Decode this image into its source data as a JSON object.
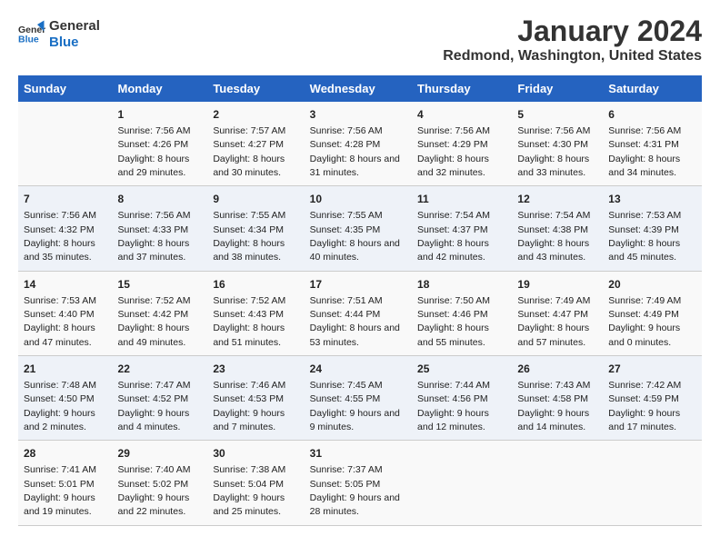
{
  "header": {
    "logo_line1": "General",
    "logo_line2": "Blue",
    "title": "January 2024",
    "subtitle": "Redmond, Washington, United States"
  },
  "days_of_week": [
    "Sunday",
    "Monday",
    "Tuesday",
    "Wednesday",
    "Thursday",
    "Friday",
    "Saturday"
  ],
  "weeks": [
    [
      {
        "day": "",
        "sunrise": "",
        "sunset": "",
        "daylight": ""
      },
      {
        "day": "1",
        "sunrise": "Sunrise: 7:56 AM",
        "sunset": "Sunset: 4:26 PM",
        "daylight": "Daylight: 8 hours and 29 minutes."
      },
      {
        "day": "2",
        "sunrise": "Sunrise: 7:57 AM",
        "sunset": "Sunset: 4:27 PM",
        "daylight": "Daylight: 8 hours and 30 minutes."
      },
      {
        "day": "3",
        "sunrise": "Sunrise: 7:56 AM",
        "sunset": "Sunset: 4:28 PM",
        "daylight": "Daylight: 8 hours and 31 minutes."
      },
      {
        "day": "4",
        "sunrise": "Sunrise: 7:56 AM",
        "sunset": "Sunset: 4:29 PM",
        "daylight": "Daylight: 8 hours and 32 minutes."
      },
      {
        "day": "5",
        "sunrise": "Sunrise: 7:56 AM",
        "sunset": "Sunset: 4:30 PM",
        "daylight": "Daylight: 8 hours and 33 minutes."
      },
      {
        "day": "6",
        "sunrise": "Sunrise: 7:56 AM",
        "sunset": "Sunset: 4:31 PM",
        "daylight": "Daylight: 8 hours and 34 minutes."
      }
    ],
    [
      {
        "day": "7",
        "sunrise": "Sunrise: 7:56 AM",
        "sunset": "Sunset: 4:32 PM",
        "daylight": "Daylight: 8 hours and 35 minutes."
      },
      {
        "day": "8",
        "sunrise": "Sunrise: 7:56 AM",
        "sunset": "Sunset: 4:33 PM",
        "daylight": "Daylight: 8 hours and 37 minutes."
      },
      {
        "day": "9",
        "sunrise": "Sunrise: 7:55 AM",
        "sunset": "Sunset: 4:34 PM",
        "daylight": "Daylight: 8 hours and 38 minutes."
      },
      {
        "day": "10",
        "sunrise": "Sunrise: 7:55 AM",
        "sunset": "Sunset: 4:35 PM",
        "daylight": "Daylight: 8 hours and 40 minutes."
      },
      {
        "day": "11",
        "sunrise": "Sunrise: 7:54 AM",
        "sunset": "Sunset: 4:37 PM",
        "daylight": "Daylight: 8 hours and 42 minutes."
      },
      {
        "day": "12",
        "sunrise": "Sunrise: 7:54 AM",
        "sunset": "Sunset: 4:38 PM",
        "daylight": "Daylight: 8 hours and 43 minutes."
      },
      {
        "day": "13",
        "sunrise": "Sunrise: 7:53 AM",
        "sunset": "Sunset: 4:39 PM",
        "daylight": "Daylight: 8 hours and 45 minutes."
      }
    ],
    [
      {
        "day": "14",
        "sunrise": "Sunrise: 7:53 AM",
        "sunset": "Sunset: 4:40 PM",
        "daylight": "Daylight: 8 hours and 47 minutes."
      },
      {
        "day": "15",
        "sunrise": "Sunrise: 7:52 AM",
        "sunset": "Sunset: 4:42 PM",
        "daylight": "Daylight: 8 hours and 49 minutes."
      },
      {
        "day": "16",
        "sunrise": "Sunrise: 7:52 AM",
        "sunset": "Sunset: 4:43 PM",
        "daylight": "Daylight: 8 hours and 51 minutes."
      },
      {
        "day": "17",
        "sunrise": "Sunrise: 7:51 AM",
        "sunset": "Sunset: 4:44 PM",
        "daylight": "Daylight: 8 hours and 53 minutes."
      },
      {
        "day": "18",
        "sunrise": "Sunrise: 7:50 AM",
        "sunset": "Sunset: 4:46 PM",
        "daylight": "Daylight: 8 hours and 55 minutes."
      },
      {
        "day": "19",
        "sunrise": "Sunrise: 7:49 AM",
        "sunset": "Sunset: 4:47 PM",
        "daylight": "Daylight: 8 hours and 57 minutes."
      },
      {
        "day": "20",
        "sunrise": "Sunrise: 7:49 AM",
        "sunset": "Sunset: 4:49 PM",
        "daylight": "Daylight: 9 hours and 0 minutes."
      }
    ],
    [
      {
        "day": "21",
        "sunrise": "Sunrise: 7:48 AM",
        "sunset": "Sunset: 4:50 PM",
        "daylight": "Daylight: 9 hours and 2 minutes."
      },
      {
        "day": "22",
        "sunrise": "Sunrise: 7:47 AM",
        "sunset": "Sunset: 4:52 PM",
        "daylight": "Daylight: 9 hours and 4 minutes."
      },
      {
        "day": "23",
        "sunrise": "Sunrise: 7:46 AM",
        "sunset": "Sunset: 4:53 PM",
        "daylight": "Daylight: 9 hours and 7 minutes."
      },
      {
        "day": "24",
        "sunrise": "Sunrise: 7:45 AM",
        "sunset": "Sunset: 4:55 PM",
        "daylight": "Daylight: 9 hours and 9 minutes."
      },
      {
        "day": "25",
        "sunrise": "Sunrise: 7:44 AM",
        "sunset": "Sunset: 4:56 PM",
        "daylight": "Daylight: 9 hours and 12 minutes."
      },
      {
        "day": "26",
        "sunrise": "Sunrise: 7:43 AM",
        "sunset": "Sunset: 4:58 PM",
        "daylight": "Daylight: 9 hours and 14 minutes."
      },
      {
        "day": "27",
        "sunrise": "Sunrise: 7:42 AM",
        "sunset": "Sunset: 4:59 PM",
        "daylight": "Daylight: 9 hours and 17 minutes."
      }
    ],
    [
      {
        "day": "28",
        "sunrise": "Sunrise: 7:41 AM",
        "sunset": "Sunset: 5:01 PM",
        "daylight": "Daylight: 9 hours and 19 minutes."
      },
      {
        "day": "29",
        "sunrise": "Sunrise: 7:40 AM",
        "sunset": "Sunset: 5:02 PM",
        "daylight": "Daylight: 9 hours and 22 minutes."
      },
      {
        "day": "30",
        "sunrise": "Sunrise: 7:38 AM",
        "sunset": "Sunset: 5:04 PM",
        "daylight": "Daylight: 9 hours and 25 minutes."
      },
      {
        "day": "31",
        "sunrise": "Sunrise: 7:37 AM",
        "sunset": "Sunset: 5:05 PM",
        "daylight": "Daylight: 9 hours and 28 minutes."
      },
      {
        "day": "",
        "sunrise": "",
        "sunset": "",
        "daylight": ""
      },
      {
        "day": "",
        "sunrise": "",
        "sunset": "",
        "daylight": ""
      },
      {
        "day": "",
        "sunrise": "",
        "sunset": "",
        "daylight": ""
      }
    ]
  ]
}
